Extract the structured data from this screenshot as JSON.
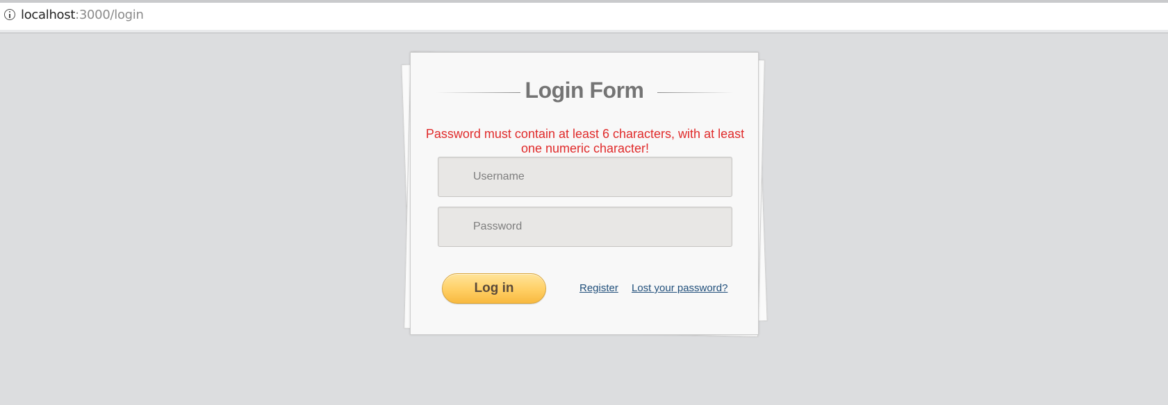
{
  "browser": {
    "url_host": "localhost",
    "url_rest": ":3000/login",
    "info_icon": "info-circle-icon"
  },
  "login_form": {
    "title": "Login Form",
    "error_message": "Password must contain at least 6 characters, with at least one numeric character!",
    "username": {
      "placeholder": "Username",
      "value": ""
    },
    "password": {
      "placeholder": "Password",
      "value": ""
    },
    "login_label": "Log in",
    "register_label": "Register",
    "lost_password_label": "Lost your password?"
  },
  "colors": {
    "page_background": "#dcdddf",
    "card_background": "#f8f8f8",
    "error_text": "#e02a2a",
    "title_text": "#747474",
    "button_gradient_top": "#ffe49a",
    "button_gradient_bottom": "#f8b93f",
    "link_text": "#1f4e7a"
  }
}
